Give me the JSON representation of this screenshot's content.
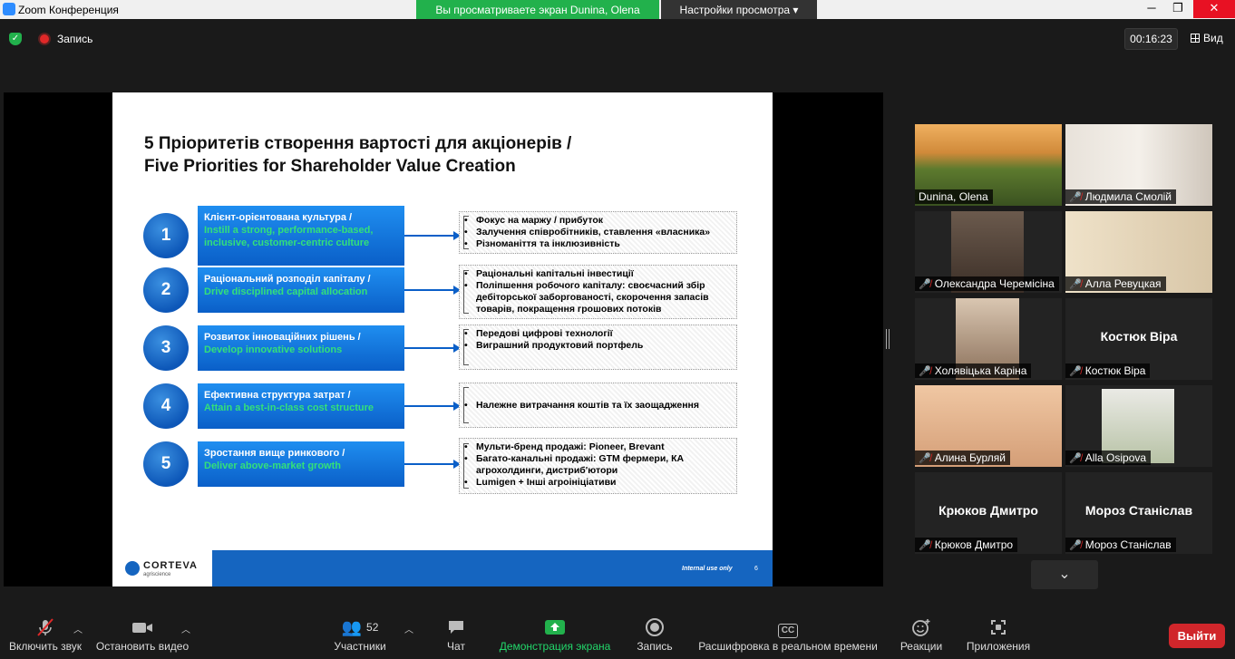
{
  "window": {
    "title": "Zoom Конференция",
    "share_banner": "Вы просматриваете экран Dunina, Olena",
    "view_options": "Настройки просмотра ▾",
    "minimize": "─",
    "restore": "❐",
    "close": "✕"
  },
  "topbar": {
    "record_label": "Запись",
    "timer": "00:16:23",
    "view_label": "Вид"
  },
  "slide": {
    "title_ua": "5 Пріоритетів створення вартості для акціонерів /",
    "title_en": "Five Priorities for Shareholder Value Creation",
    "priorities": [
      {
        "num": "1",
        "ua": "Клієнт-орієнтована культура /",
        "en": "Instill a strong, performance-based, inclusive, customer-centric culture",
        "bullets": [
          "Фокус на маржу / прибуток",
          "Залучення співробітників, ставлення «власника»",
          "Різноманіття та інклюзивність"
        ]
      },
      {
        "num": "2",
        "ua": "Раціональний розподіл капіталу /",
        "en": "Drive disciplined capital allocation",
        "bullets": [
          "Раціональні капітальні інвестиції",
          "Поліпшення робочого капіталу: своєчасний збір дебіторської заборгованості, скорочення запасів товарів, покращення грошових потоків"
        ]
      },
      {
        "num": "3",
        "ua": "Розвиток інноваційних рішень /",
        "en": "Develop innovative solutions",
        "bullets": [
          "Передові цифрові технології",
          "Виграшний продуктовий портфель"
        ]
      },
      {
        "num": "4",
        "ua": "Ефективна структура затрат /",
        "en": "Attain a best-in-class cost structure",
        "bullets": [
          "Належне витрачання коштів та їх заощадження"
        ]
      },
      {
        "num": "5",
        "ua": "Зростання вище ринкового /",
        "en": "Deliver above-market growth",
        "bullets": [
          "Мульти-бренд продажі: Pioneer, Brevant",
          "Багато-канальні продажі: GTM фермери, КА агрохолдинги, дистриб'ютори",
          "Lumigen + Інші агроініціативи"
        ]
      }
    ],
    "logo_name": "CORTEVA",
    "logo_sub": "agriscience",
    "footer_note": "Internal use only",
    "page_number": "6"
  },
  "participants": [
    {
      "name": "Dunina, Olena",
      "muted": false,
      "video": true,
      "active": true
    },
    {
      "name": "Людмила Смолій",
      "muted": true,
      "video": true
    },
    {
      "name": "Олександра Черемісіна",
      "muted": true,
      "video": true
    },
    {
      "name": "Алла Ревуцкая",
      "muted": true,
      "video": true
    },
    {
      "name": "Холявіцька Каріна",
      "muted": true,
      "video": true
    },
    {
      "name": "Костюк Віра",
      "muted": true,
      "video": false,
      "big_name": "Костюк Віра"
    },
    {
      "name": "Алина Бурляй",
      "muted": true,
      "video": true
    },
    {
      "name": "Alla Osipova",
      "muted": true,
      "video": true
    },
    {
      "name": "Крюков Дмитро",
      "muted": true,
      "video": false,
      "big_name": "Крюков Дмитро"
    },
    {
      "name": "Мороз Станіслав",
      "muted": true,
      "video": false,
      "big_name": "Мороз Станіслав"
    }
  ],
  "toolbar": {
    "unmute": "Включить звук",
    "stop_video": "Остановить видео",
    "participants": "Участники",
    "participants_count": "52",
    "chat": "Чат",
    "share": "Демонстрация экрана",
    "record": "Запись",
    "cc": "Расшифровка в реальном времени",
    "cc_icon": "CC",
    "reactions": "Реакции",
    "apps": "Приложения",
    "leave": "Выйти"
  },
  "colors": {
    "accent_green": "#22b14c",
    "leave_red": "#d0262b",
    "slide_blue": "#1565c0",
    "active_speaker": "#c5e84a"
  }
}
